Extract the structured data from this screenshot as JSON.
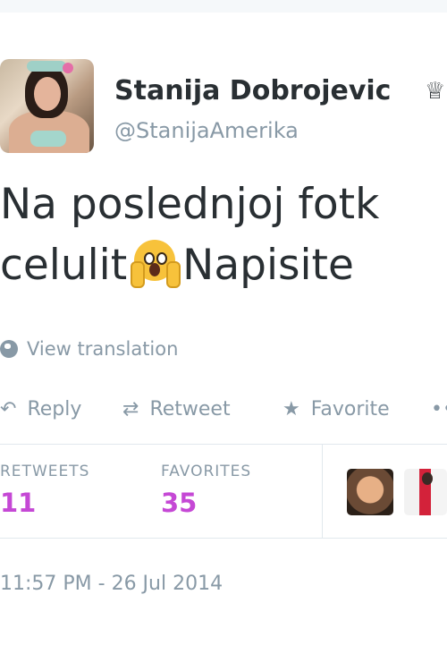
{
  "tweet": {
    "author": {
      "display_name": "Stanija Dobrojevic",
      "verified_symbol": "♕",
      "username": "@StanijaAmerika"
    },
    "text_line_1": "Na poslednjoj fotk",
    "text_line_2_before_emoji": "celulit",
    "emoji": "face-screaming-in-fear",
    "text_line_2_after_emoji": "Napisite",
    "translation_link": "View translation",
    "actions": {
      "reply": "Reply",
      "retweet": "Retweet",
      "favorite": "Favorite",
      "more": "••"
    },
    "stats": {
      "retweets_label": "RETWEETS",
      "retweets_count": "11",
      "favorites_label": "FAVORITES",
      "favorites_count": "35"
    },
    "timestamp": "11:57 PM - 26 Jul 2014",
    "colors": {
      "accent": "#c548d5",
      "secondary_text": "#8899a6",
      "primary_text": "#292f33"
    }
  }
}
